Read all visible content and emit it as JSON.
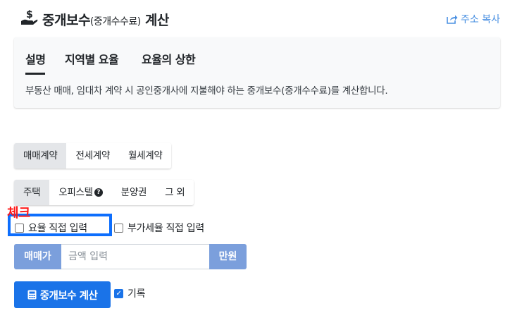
{
  "header": {
    "title_main": "중개보수",
    "title_sub": "(중개수수료)",
    "title_end": " 계산",
    "copy_label": "주소 복사"
  },
  "info": {
    "tabs": [
      {
        "label": "설명"
      },
      {
        "label": "지역별 요율"
      },
      {
        "label": "요율의 상한"
      }
    ],
    "text": "부동산 매매, 임대차 계약 시 공인중개사에 지불해야 하는 중개보수(중개수수료)를 계산합니다."
  },
  "contract_types": [
    "매매계약",
    "전세계약",
    "월세계약"
  ],
  "property_types": [
    "주택",
    "오피스텔",
    "분양권",
    "그 외"
  ],
  "annotation": {
    "label": "체크"
  },
  "options": {
    "rate_direct": "요율 직접 입력",
    "vat_direct": "부가세율 직접 입력",
    "record": "기록"
  },
  "price": {
    "label": "매매가",
    "placeholder": "금액 입력",
    "unit": "만원"
  },
  "calc_button": "중개보수 계산",
  "colors": {
    "primary": "#1a73e8",
    "addon": "#7b9fdc",
    "annotation_text": "#ff1a1a",
    "annotation_box": "#0d6efd",
    "link": "#4a90e2"
  }
}
